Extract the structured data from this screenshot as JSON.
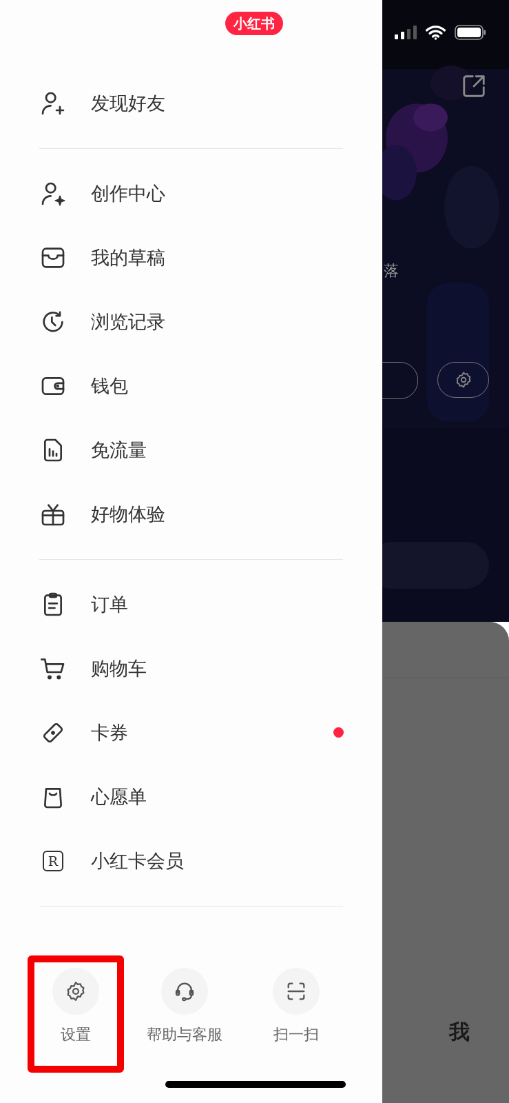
{
  "logo": "小红书",
  "menu_groups": [
    [
      {
        "label": "发现好友",
        "dot": false
      }
    ],
    [
      {
        "label": "创作中心",
        "dot": false
      },
      {
        "label": "我的草稿",
        "dot": false
      },
      {
        "label": "浏览记录",
        "dot": false
      },
      {
        "label": "钱包",
        "dot": false
      },
      {
        "label": "免流量",
        "dot": false
      },
      {
        "label": "好物体验",
        "dot": false
      }
    ],
    [
      {
        "label": "订单",
        "dot": false
      },
      {
        "label": "购物车",
        "dot": false
      },
      {
        "label": "卡券",
        "dot": true
      },
      {
        "label": "心愿单",
        "dot": false
      },
      {
        "label": "小红卡会员",
        "dot": false,
        "icon_letter": "R"
      }
    ]
  ],
  "bottom_actions": [
    {
      "label": "设置",
      "highlighted": true
    },
    {
      "label": "帮助与客服",
      "highlighted": false
    },
    {
      "label": "扫一扫",
      "highlighted": false
    }
  ],
  "background_page": {
    "side_text": "落",
    "tab_label": "我"
  }
}
